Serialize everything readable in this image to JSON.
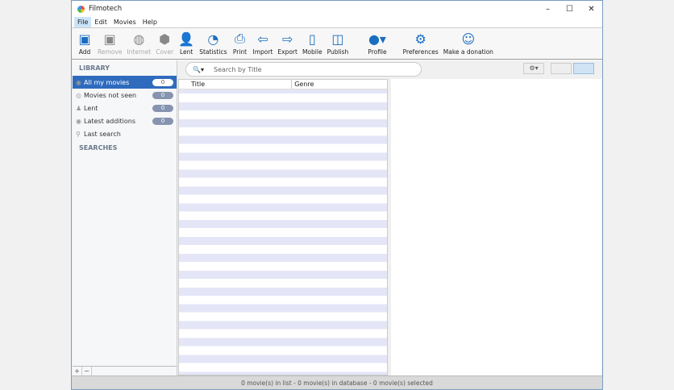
{
  "window": {
    "title": "Filmotech",
    "controls": [
      "–",
      "☐",
      "✕"
    ]
  },
  "menu": [
    "File",
    "Edit",
    "Movies",
    "Help"
  ],
  "toolbar": [
    {
      "label": "Add",
      "icon": "▣",
      "enabled": true
    },
    {
      "label": "Remove",
      "icon": "▣",
      "enabled": false
    },
    {
      "label": "Internet",
      "icon": "◍",
      "enabled": false
    },
    {
      "label": "Cover",
      "icon": "⬢",
      "enabled": false
    },
    {
      "label": "Lent",
      "icon": "👤",
      "enabled": true
    },
    {
      "label": "Statistics",
      "icon": "◔",
      "enabled": true
    },
    {
      "label": "Print",
      "icon": "⎙",
      "enabled": true
    },
    {
      "label": "Import",
      "icon": "⇦",
      "enabled": true
    },
    {
      "label": "Export",
      "icon": "⇨",
      "enabled": true
    },
    {
      "label": "Mobile",
      "icon": "▯",
      "enabled": true
    },
    {
      "label": "Publish",
      "icon": "◫",
      "enabled": true
    },
    {
      "label": "Profile",
      "icon": "●▾",
      "enabled": true
    },
    {
      "label": "Preferences",
      "icon": "⚙",
      "enabled": true
    },
    {
      "label": "Make a donation",
      "icon": "☺",
      "enabled": true
    }
  ],
  "sidebar": {
    "library_header": "LIBRARY",
    "searches_header": "SEARCHES",
    "items": [
      {
        "label": "All my movies",
        "icon": "◉",
        "count": "0"
      },
      {
        "label": "Movies not seen",
        "icon": "◎",
        "count": "0"
      },
      {
        "label": "Lent",
        "icon": "♟",
        "count": "0"
      },
      {
        "label": "Latest additions",
        "icon": "◉",
        "count": "0"
      },
      {
        "label": "Last search",
        "icon": "⚲",
        "count": null
      }
    ],
    "add": "+",
    "remove": "−"
  },
  "search": {
    "placeholder": "Search by Title",
    "icon": "🔍▾"
  },
  "gear": "⚙▾",
  "list": {
    "columns": [
      "Title",
      "Genre"
    ]
  },
  "status": "0 movie(s) in list - 0 movie(s) in database - 0 movie(s) selected"
}
